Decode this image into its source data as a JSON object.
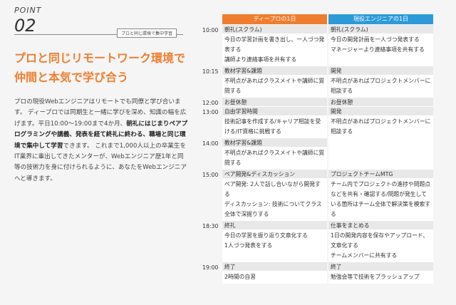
{
  "point": {
    "label": "POINT",
    "number": "02",
    "tag": "プロと同じ環境で集中学習"
  },
  "headline": {
    "line1": "プロと同じリモートワーク環境で",
    "line2": "仲間と本気で学び合う"
  },
  "body": {
    "p1": "プロの現役Webエンジニアはリモートでも同僚と学び合います。 ディープロでは同期生と一緒に学びを深め、知識の幅を広げます。平日10:00〜19:00まで4か月、",
    "bold": "朝礼にはじまりペアプログラミングや講義、発表を経て終礼に終わる、職場と同じ環境で集中して学習",
    "p2": "できます。 これまで1,000人以上の卒業生をIT業界に輩出してきたメンターが、Webエンジニア歴1年と同等の技術力を身に付けられるように、あなたをWebエンジニアへと導きます。"
  },
  "schedule": {
    "col1_header": "ディープロの1日",
    "col2_header": "現役エンジニアの1日",
    "rows": [
      {
        "time": "10:00",
        "a_title": "朝礼(スクラム)",
        "a_lines": [
          "今日の学習計画を書き出し、一人づつ発表する",
          "講師より連絡事項を共有する"
        ],
        "b_title": "朝礼(スクラム)",
        "b_lines": [
          "今日の開発計画を一人づつ発表する",
          "マネージャーより連絡事項を共有する"
        ]
      },
      {
        "time": "10:15",
        "a_title": "教材学習&課題",
        "a_lines": [
          "不明点があればクラスメイトや講師に質問する"
        ],
        "b_title": "開発",
        "b_lines": [
          "不明点があればプロジェクトメンバーに相談する"
        ]
      },
      {
        "time": "12:00",
        "a_title": "お昼休憩",
        "a_lines": [],
        "b_title": "お昼休憩",
        "b_lines": []
      },
      {
        "time": "13:00",
        "a_title": "自由学習時間",
        "a_lines": [
          "技術記事を作成する/キャリア相談を受ける/IT資格に挑戦する"
        ],
        "b_title": "開発",
        "b_lines": [
          "不明点があればプロジェクトメンバーに相談する"
        ]
      },
      {
        "time": "14:00",
        "a_title": "教材学習&課題",
        "a_lines": [
          "不明点があればクラスメイトや講師に質問する"
        ],
        "b_title": "",
        "b_lines": []
      },
      {
        "time": "15:00",
        "a_title": "ペア開発&ディスカッション",
        "a_lines": [
          "ペア開発: 2人で話し合いながら開発する",
          "ディスカッション: 技術についてクラス全体で深掘りする"
        ],
        "b_title": "プロジェクトチームMTG",
        "b_lines": [
          "チーム内でプロジェクトの進捗や問題点などを共有・確認する/問題が発生している箇所はチーム全体で解決策を模索する"
        ]
      },
      {
        "time": "18:30",
        "a_title": "終礼",
        "a_lines": [
          "今日の学習を振り返り文章化する",
          "1人づつ発表をする"
        ],
        "b_title": "仕事をまとめる",
        "b_lines": [
          "1日の開発内容を保存やアップロード、文章化する",
          "チームメンバーに共有する"
        ]
      },
      {
        "time": "19:00",
        "a_title": "終了",
        "a_lines": [
          "2時間の自習"
        ],
        "b_title": "終了",
        "b_lines": [
          "勉強会等で技術をブラッシュアップ"
        ]
      }
    ]
  },
  "colors": {
    "accent_orange": "#ef7d2e",
    "accent_blue": "#2d9ad8"
  }
}
